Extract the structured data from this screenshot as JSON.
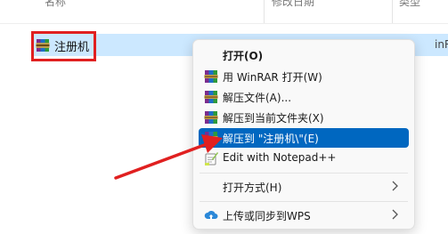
{
  "explorer": {
    "columns": [
      "名称",
      "修改日期",
      "类型"
    ],
    "file": {
      "name": "注册机",
      "extra": "inRA"
    }
  },
  "context_menu": {
    "items": [
      {
        "label": "打开(O)",
        "icon": "none",
        "bold": true
      },
      {
        "label": "用 WinRAR 打开(W)",
        "icon": "winrar-icon"
      },
      {
        "label": "解压文件(A)...",
        "icon": "winrar-icon"
      },
      {
        "label": "解压到当前文件夹(X)",
        "icon": "winrar-icon"
      },
      {
        "label": "解压到 \"注册机\\\"(E)",
        "icon": "winrar-icon",
        "selected": true
      },
      {
        "label": "Edit with Notepad++",
        "icon": "notepadpp-icon"
      },
      {
        "label": "打开方式(H)",
        "icon": "none",
        "submenu": true
      },
      {
        "label": "上传或同步到WPS",
        "icon": "cloud-upload-icon",
        "submenu": true
      }
    ]
  },
  "colors": {
    "selection": "#0067c0",
    "file_row_highlight": "#cce8ff",
    "annotation_red": "#e02020"
  }
}
